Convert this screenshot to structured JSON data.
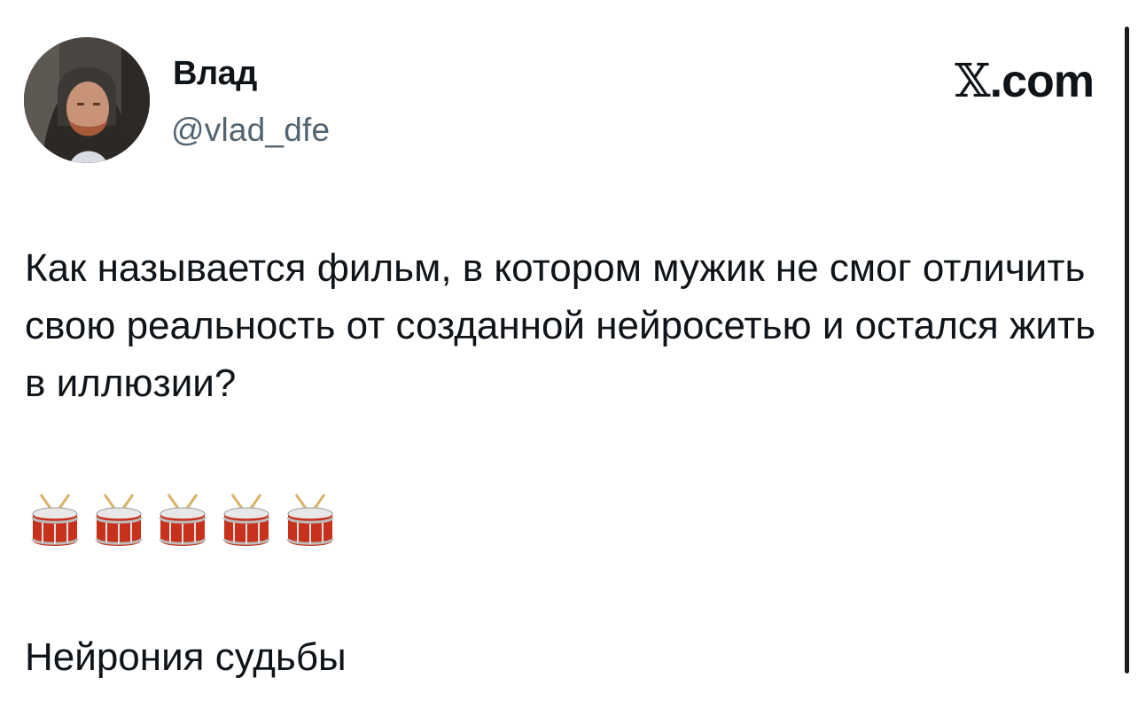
{
  "author": {
    "display_name": "Влад",
    "handle": "@vlad_dfe",
    "avatar_icon": "profile-photo"
  },
  "brand": {
    "x_glyph": "𝕏",
    "suffix": ".com"
  },
  "tweet": {
    "text": "Как называется фильм, в котором мужик не смог отличить свою реальность от созданной нейросетью и остался жить в иллюзии?",
    "emoji": [
      "drum-icon",
      "drum-icon",
      "drum-icon",
      "drum-icon",
      "drum-icon"
    ],
    "punchline": "Нейрония судьбы"
  },
  "colors": {
    "text": "#0f1419",
    "secondary": "#536471",
    "drum_red": "#c8321c"
  }
}
